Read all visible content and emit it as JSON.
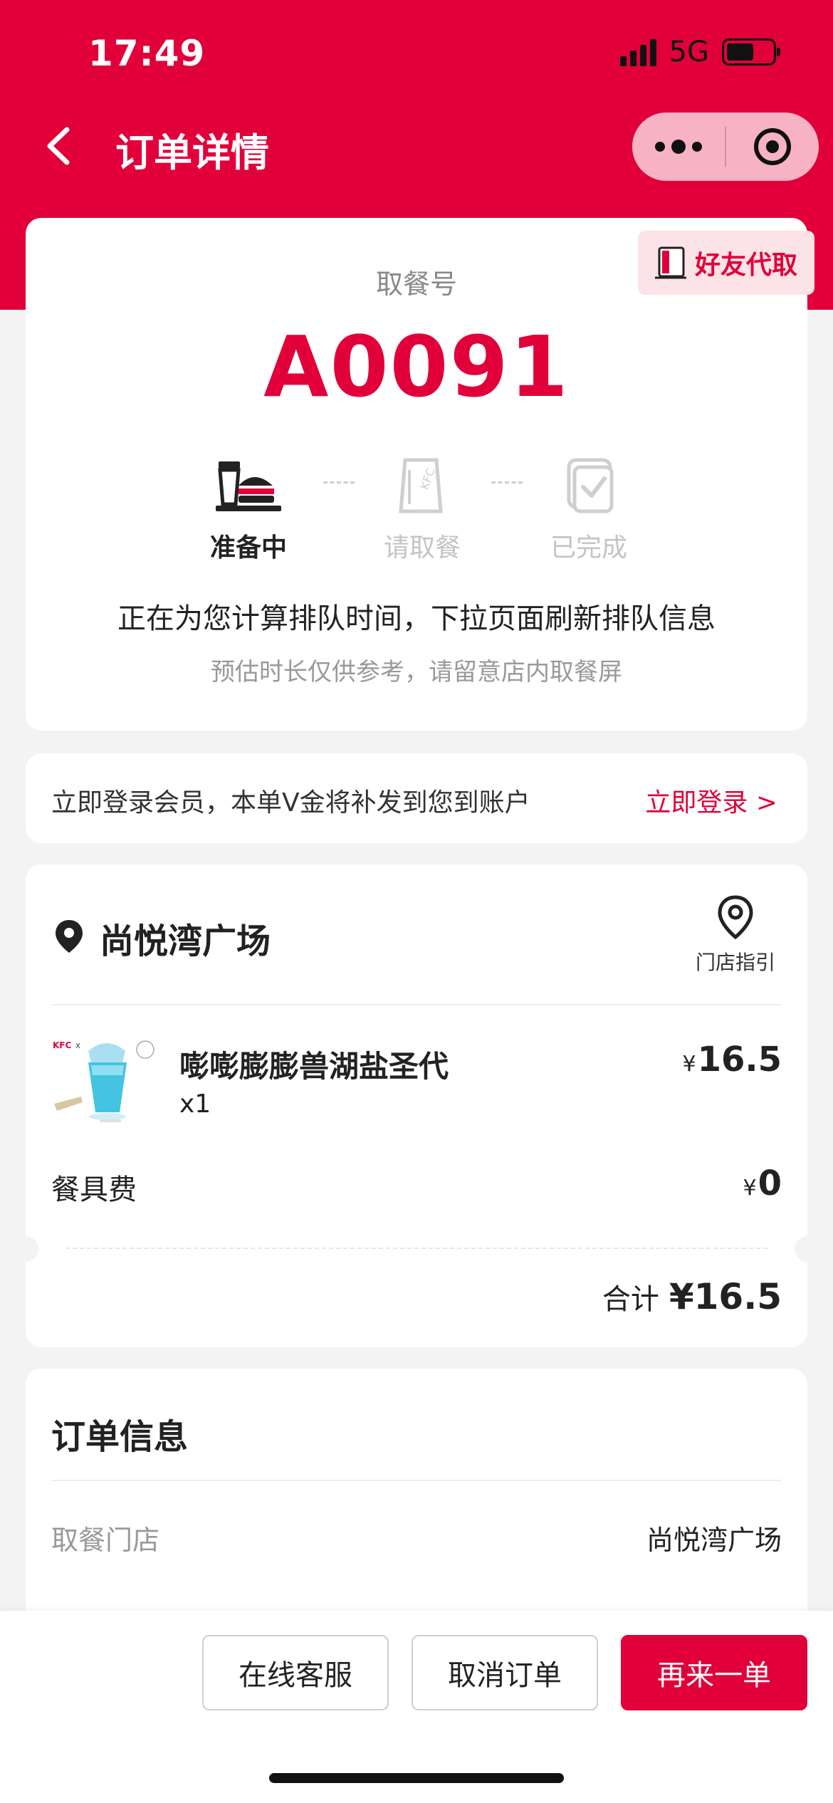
{
  "status_bar": {
    "time": "17:49",
    "network": "5G"
  },
  "nav": {
    "title": "订单详情"
  },
  "pickup": {
    "friend_button": "好友代取",
    "label": "取餐号",
    "number": "A0091",
    "steps": [
      {
        "label": "准备中",
        "active": true
      },
      {
        "label": "请取餐",
        "active": false
      },
      {
        "label": "已完成",
        "active": false
      }
    ],
    "queue_main": "正在为您计算排队时间，下拉页面刷新排队信息",
    "queue_sub": "预估时长仅供参考，请留意店内取餐屏"
  },
  "login": {
    "text": "立即登录会员，本单V金将补发到您到账户",
    "link": "立即登录 >"
  },
  "order": {
    "store_name": "尚悦湾广场",
    "store_guide": "门店指引",
    "items": [
      {
        "name": "嘭嘭膨膨兽湖盐圣代",
        "qty": "x1",
        "currency": "¥",
        "price": "16.5"
      }
    ],
    "fee": {
      "label": "餐具费",
      "currency": "¥",
      "price": "0"
    },
    "total": {
      "label": "合计",
      "value": "¥16.5"
    }
  },
  "info": {
    "title": "订单信息",
    "rows": [
      {
        "label": "取餐门店",
        "value": "尚悦湾广场"
      }
    ]
  },
  "actions": {
    "service": "在线客服",
    "cancel": "取消订单",
    "reorder": "再来一单"
  },
  "colors": {
    "brand_red": "#e1003a",
    "background": "#f3f3f3",
    "capsule_pink": "#f7b3c3"
  }
}
